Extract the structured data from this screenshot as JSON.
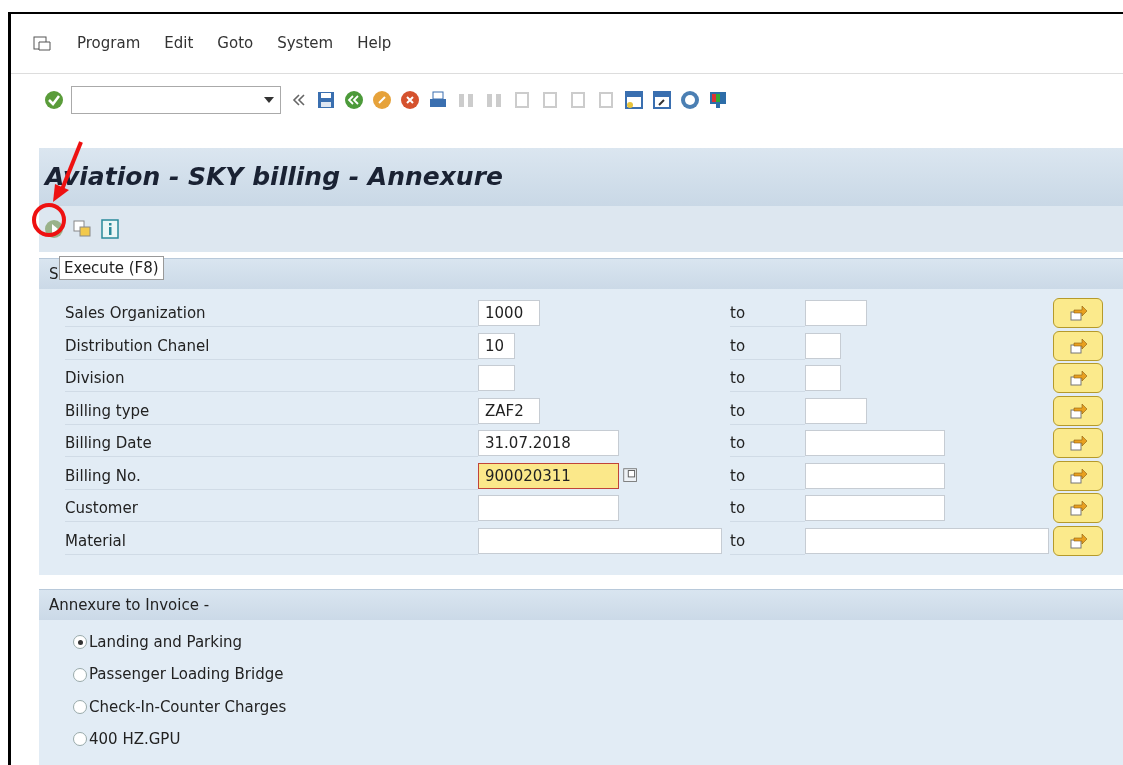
{
  "menu": [
    "Program",
    "Edit",
    "Goto",
    "System",
    "Help"
  ],
  "title": "Aviation - SKY billing - Annexure",
  "tooltip": "Execute  (F8)",
  "selection": {
    "title": "S",
    "rows": [
      {
        "label": "Sales Organization",
        "low": "1000",
        "to": "to",
        "high": "",
        "focused": false
      },
      {
        "label": "Distribution Chanel",
        "low": "10",
        "to": "to",
        "high": "",
        "focused": false
      },
      {
        "label": "Division",
        "low": "",
        "to": "to",
        "high": "",
        "focused": false
      },
      {
        "label": "Billing type",
        "low": "ZAF2",
        "to": "to",
        "high": "",
        "focused": false
      },
      {
        "label": "Billing Date",
        "low": "31.07.2018",
        "to": "to",
        "high": "",
        "focused": false
      },
      {
        "label": "Billing No.",
        "low": "900020311",
        "to": "to",
        "high": "",
        "focused": true
      },
      {
        "label": "Customer",
        "low": "",
        "to": "to",
        "high": "",
        "focused": false
      },
      {
        "label": "Material",
        "low": "",
        "to": "to",
        "high": "",
        "focused": false
      }
    ]
  },
  "annexure": {
    "title": "Annexure to Invoice -",
    "options": [
      {
        "label": "Landing and Parking",
        "selected": true
      },
      {
        "label": "Passenger Loading Bridge",
        "selected": false
      },
      {
        "label": "Check-In-Counter Charges",
        "selected": false
      },
      {
        "label": "400 HZ.GPU",
        "selected": false
      }
    ]
  }
}
